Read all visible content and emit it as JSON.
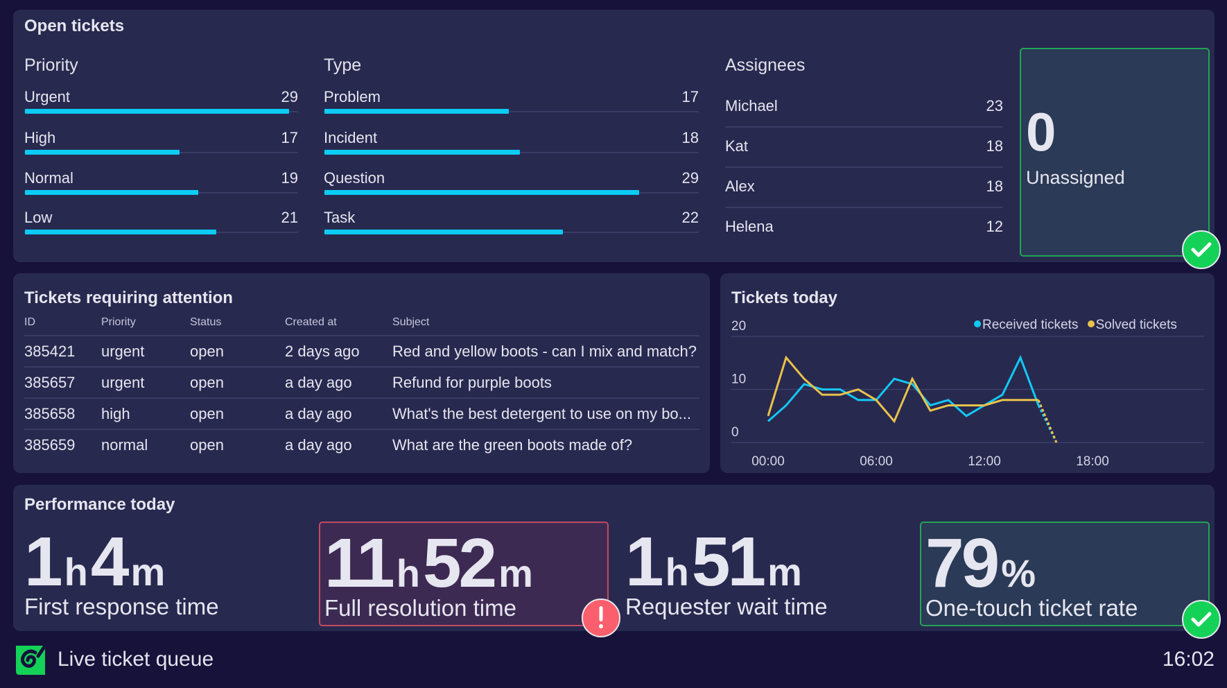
{
  "open_tickets": {
    "title": "Open tickets",
    "priority": {
      "title": "Priority",
      "scale_max": 30,
      "items": [
        {
          "label": "Urgent",
          "value": 29
        },
        {
          "label": "High",
          "value": 17
        },
        {
          "label": "Normal",
          "value": 19
        },
        {
          "label": "Low",
          "value": 21
        }
      ]
    },
    "type": {
      "title": "Type",
      "scale_max": 34.5,
      "items": [
        {
          "label": "Problem",
          "value": 17
        },
        {
          "label": "Incident",
          "value": 18
        },
        {
          "label": "Question",
          "value": 29
        },
        {
          "label": "Task",
          "value": 22
        }
      ]
    },
    "assignees": {
      "title": "Assignees",
      "items": [
        {
          "name": "Michael",
          "count": 23
        },
        {
          "name": "Kat",
          "count": 18
        },
        {
          "name": "Alex",
          "count": 18
        },
        {
          "name": "Helena",
          "count": 12
        }
      ]
    },
    "unassigned": {
      "count": "0",
      "label": "Unassigned",
      "status": "ok"
    }
  },
  "attention": {
    "title": "Tickets requiring attention",
    "columns": [
      "ID",
      "Priority",
      "Status",
      "Created at",
      "Subject"
    ],
    "rows": [
      [
        "385421",
        "urgent",
        "open",
        "2 days ago",
        "Red and yellow boots - can I mix and match?"
      ],
      [
        "385657",
        "urgent",
        "open",
        "a day ago",
        "Refund for purple boots"
      ],
      [
        "385658",
        "high",
        "open",
        "a day ago",
        "What's the best detergent to use on my bo..."
      ],
      [
        "385659",
        "normal",
        "open",
        "a day ago",
        "What are the green boots made of?"
      ]
    ]
  },
  "chart_data": {
    "type": "line",
    "title": "Tickets today",
    "xlabel": "",
    "ylabel": "",
    "x": [
      0,
      1,
      2,
      3,
      4,
      5,
      6,
      7,
      8,
      9,
      10,
      11,
      12,
      13,
      14,
      15,
      16
    ],
    "x_unit": "hour",
    "xlim": [
      0,
      24
    ],
    "ylim": [
      0,
      20
    ],
    "xticks": [
      0,
      6,
      12,
      18
    ],
    "xtick_labels": [
      "00:00",
      "06:00",
      "12:00",
      "18:00"
    ],
    "yticks": [
      0,
      10,
      20
    ],
    "ytick_labels": [
      "0",
      "10",
      "20"
    ],
    "grid": true,
    "legend": "top-right",
    "projected_last_segment": true,
    "series": [
      {
        "name": "Received tickets",
        "color": "#13c8f4",
        "values": [
          4,
          7,
          11,
          10,
          10,
          8,
          8,
          12,
          11,
          7,
          8,
          5,
          7,
          9,
          16,
          7,
          0
        ]
      },
      {
        "name": "Solved tickets",
        "color": "#e8c34b",
        "values": [
          5,
          16,
          12,
          9,
          9,
          10,
          8,
          4,
          12,
          6,
          7,
          7,
          7,
          8,
          8,
          8,
          0
        ]
      }
    ]
  },
  "performance": {
    "title": "Performance today",
    "metrics": [
      {
        "parts": [
          {
            "n": "1",
            "u": "h"
          },
          {
            "n": "4",
            "u": "m"
          }
        ],
        "label": "First response time",
        "status": "none"
      },
      {
        "parts": [
          {
            "n": "11",
            "u": "h"
          },
          {
            "n": "52",
            "u": "m"
          }
        ],
        "label": "Full resolution time",
        "status": "alert"
      },
      {
        "parts": [
          {
            "n": "1",
            "u": "h"
          },
          {
            "n": "51",
            "u": "m"
          }
        ],
        "label": "Requester wait time",
        "status": "none"
      },
      {
        "parts": [
          {
            "n": "79",
            "u": "%"
          }
        ],
        "label": "One-touch ticket rate",
        "status": "ok"
      }
    ]
  },
  "footer": {
    "title": "Live ticket queue",
    "time": "16:02"
  },
  "colors": {
    "background": "#16123a",
    "panel": "#28294f",
    "bar": "#0bccf5",
    "ok": "#14d257",
    "alert": "#fb5f6d"
  }
}
